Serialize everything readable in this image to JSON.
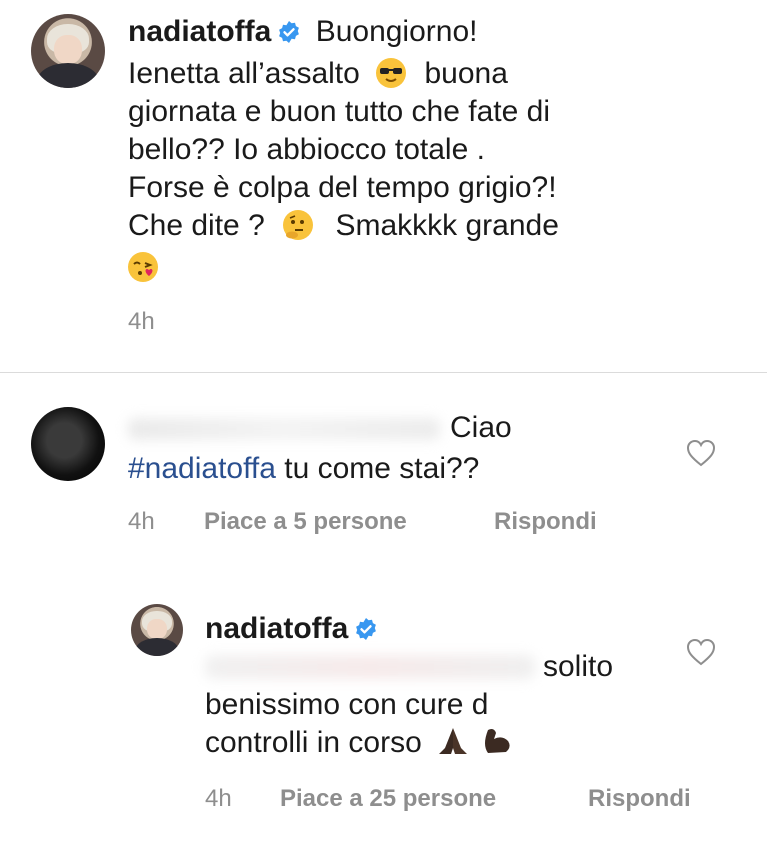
{
  "post": {
    "username": "nadiatoffa",
    "lines": [
      "Buongiorno!",
      "Ienetta all’assalto",
      "buona",
      "giornata e buon tutto che fate di",
      "bello?? Io abbiocco totale .",
      "Forse è colpa del tempo grigio?!",
      "Che dite ?",
      "Smakkkk grande"
    ],
    "time": "4h"
  },
  "comment": {
    "text_1": "Ciao",
    "hashtag": "#nadiatoffa",
    "text_2": " tu come stai??",
    "time": "4h",
    "likes": "Piace a 5 persone",
    "reply": "Rispondi"
  },
  "reply": {
    "username": "nadiatoffa",
    "line_1": "solito",
    "line_2": "benissimo con cure d",
    "line_3": "controlli in corso",
    "time": "4h",
    "likes": "Piace a 25 persone",
    "reply": "Rispondi"
  },
  "icons": {
    "verified": "verified-badge-icon",
    "heart": "heart-outline-icon",
    "emoji_sunglasses": "sunglasses-emoji-icon",
    "emoji_thinking": "thinking-face-emoji-icon",
    "emoji_kiss": "kissing-heart-emoji-icon",
    "emoji_pray": "folded-hands-emoji-icon",
    "emoji_muscle": "flexed-biceps-emoji-icon"
  },
  "colors": {
    "verified": "#3897f0",
    "hashtag": "#2a4f8f",
    "meta": "#8e8e8e",
    "divider": "#dbdbdb"
  }
}
